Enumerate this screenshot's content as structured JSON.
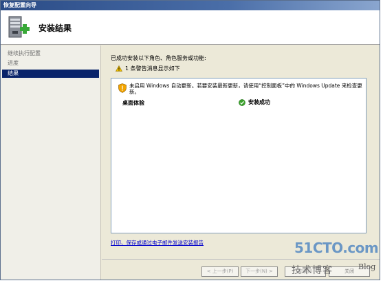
{
  "window": {
    "title": "恢复配置向导"
  },
  "header": {
    "title": "安装结果"
  },
  "sidebar": {
    "items": [
      {
        "label": "继续执行配置",
        "active": false
      },
      {
        "label": "进度",
        "active": false
      },
      {
        "label": "结果",
        "active": true
      }
    ]
  },
  "main": {
    "intro": "已成功安装以下角色、角色服务或功能:",
    "warning_summary": "1 条警告消息显示如下",
    "result_warning": "未启用 Windows 自动更新。若要安装最新更新，请使用“控制面板”中的 Windows Update 来检查更新。",
    "roles": [
      {
        "name": "桌面体验",
        "status": "安装成功"
      }
    ],
    "print_link": "打印、保存或通过电子邮件发送安装报告"
  },
  "footer": {
    "prev_label": "< 上一步(P)",
    "next_label": "下一步(N) >",
    "install_label": "安装(I)",
    "cancel_label": "关闭"
  },
  "watermark": {
    "host": "51CTO.com",
    "text": "技术博客",
    "blog": "Blog"
  },
  "colors": {
    "title_bar": "#2a4b86",
    "nav_active": "#0a246a",
    "link": "#0000cc",
    "success": "#3aa02c",
    "warning": "#f2b400"
  },
  "icons": {
    "header": "server-roles-icon",
    "warning": "warning-icon",
    "shield_warning": "shield-warning-icon",
    "success": "success-check-icon"
  }
}
